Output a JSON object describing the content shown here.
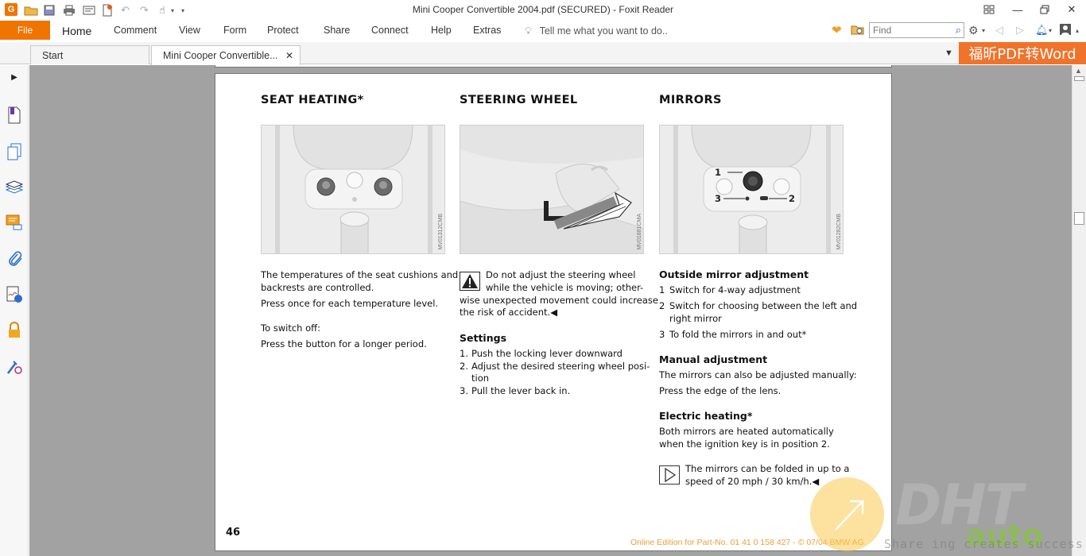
{
  "window": {
    "title": "Mini Cooper Convertible 2004.pdf (SECURED) - Foxit Reader"
  },
  "menu": {
    "file": "File",
    "items": [
      "Home",
      "Comment",
      "View",
      "Form",
      "Protect",
      "Share",
      "Connect",
      "Help",
      "Extras"
    ],
    "tell_me": "Tell me what you want to do..",
    "find_placeholder": "Find"
  },
  "tabs": [
    {
      "label": "Start"
    },
    {
      "label": "Mini Cooper Convertible..."
    }
  ],
  "promo": "福昕PDF转Word",
  "page": {
    "number": "46",
    "edition_note": "Online Edition for Part-No. 01 41 0 158 427 - © 07/04 BMW AG",
    "seat": {
      "heading": "SEAT HEATING*",
      "figure_code": "MV01312CMB",
      "p1": "The temperatures of the seat cushions and backrests are controlled.",
      "p2": "Press once for each temperature level.",
      "p3": "To switch off:",
      "p4": "Press the button for a longer period."
    },
    "steering": {
      "heading": "STEERING WHEEL",
      "figure_code": "MV01881CMA",
      "warning_l1": "Do not adjust the steering wheel",
      "warning_l2": "while the vehicle is moving; other-",
      "warning_l3": "wise unexpected movement could increase",
      "warning_l4": "the risk of accident.◀",
      "settings_title": "Settings",
      "steps": [
        {
          "n": "1.",
          "lines": [
            "Push the locking lever downward"
          ]
        },
        {
          "n": "2.",
          "lines": [
            "Adjust the desired steering wheel posi-",
            "tion"
          ]
        },
        {
          "n": "3.",
          "lines": [
            "Pull the lever back in."
          ]
        }
      ]
    },
    "mirrors": {
      "heading": "MIRRORS",
      "figure_code": "MV01282CMB",
      "callouts": [
        "1",
        "2",
        "3"
      ],
      "outside_title": "Outside mirror adjustment",
      "outside_items": [
        {
          "n": "1",
          "lines": [
            "Switch for 4-way adjustment"
          ]
        },
        {
          "n": "2",
          "lines": [
            "Switch for choosing between the left and",
            "right mirror"
          ]
        },
        {
          "n": "3",
          "lines": [
            "To fold the mirrors in and out*"
          ]
        }
      ],
      "manual_title": "Manual adjustment",
      "manual_p1": "The mirrors can also be adjusted manually:",
      "manual_p2": "Press the edge of the lens.",
      "electric_title": "Electric heating*",
      "electric_l1": "Both mirrors are heated automatically",
      "electric_l2": "when the ignition key is in position 2.",
      "note_l1": "The mirrors can be folded in up to a",
      "note_l2": "speed of 20 mph / 30 km/h.◀"
    }
  },
  "watermark": {
    "brand": "DHT",
    "auto": "auto",
    "tagline": "Share ing creates success"
  },
  "colors": {
    "accent": "#f07400",
    "promo": "#f0732b",
    "doc_background": "#a2a2a2"
  }
}
